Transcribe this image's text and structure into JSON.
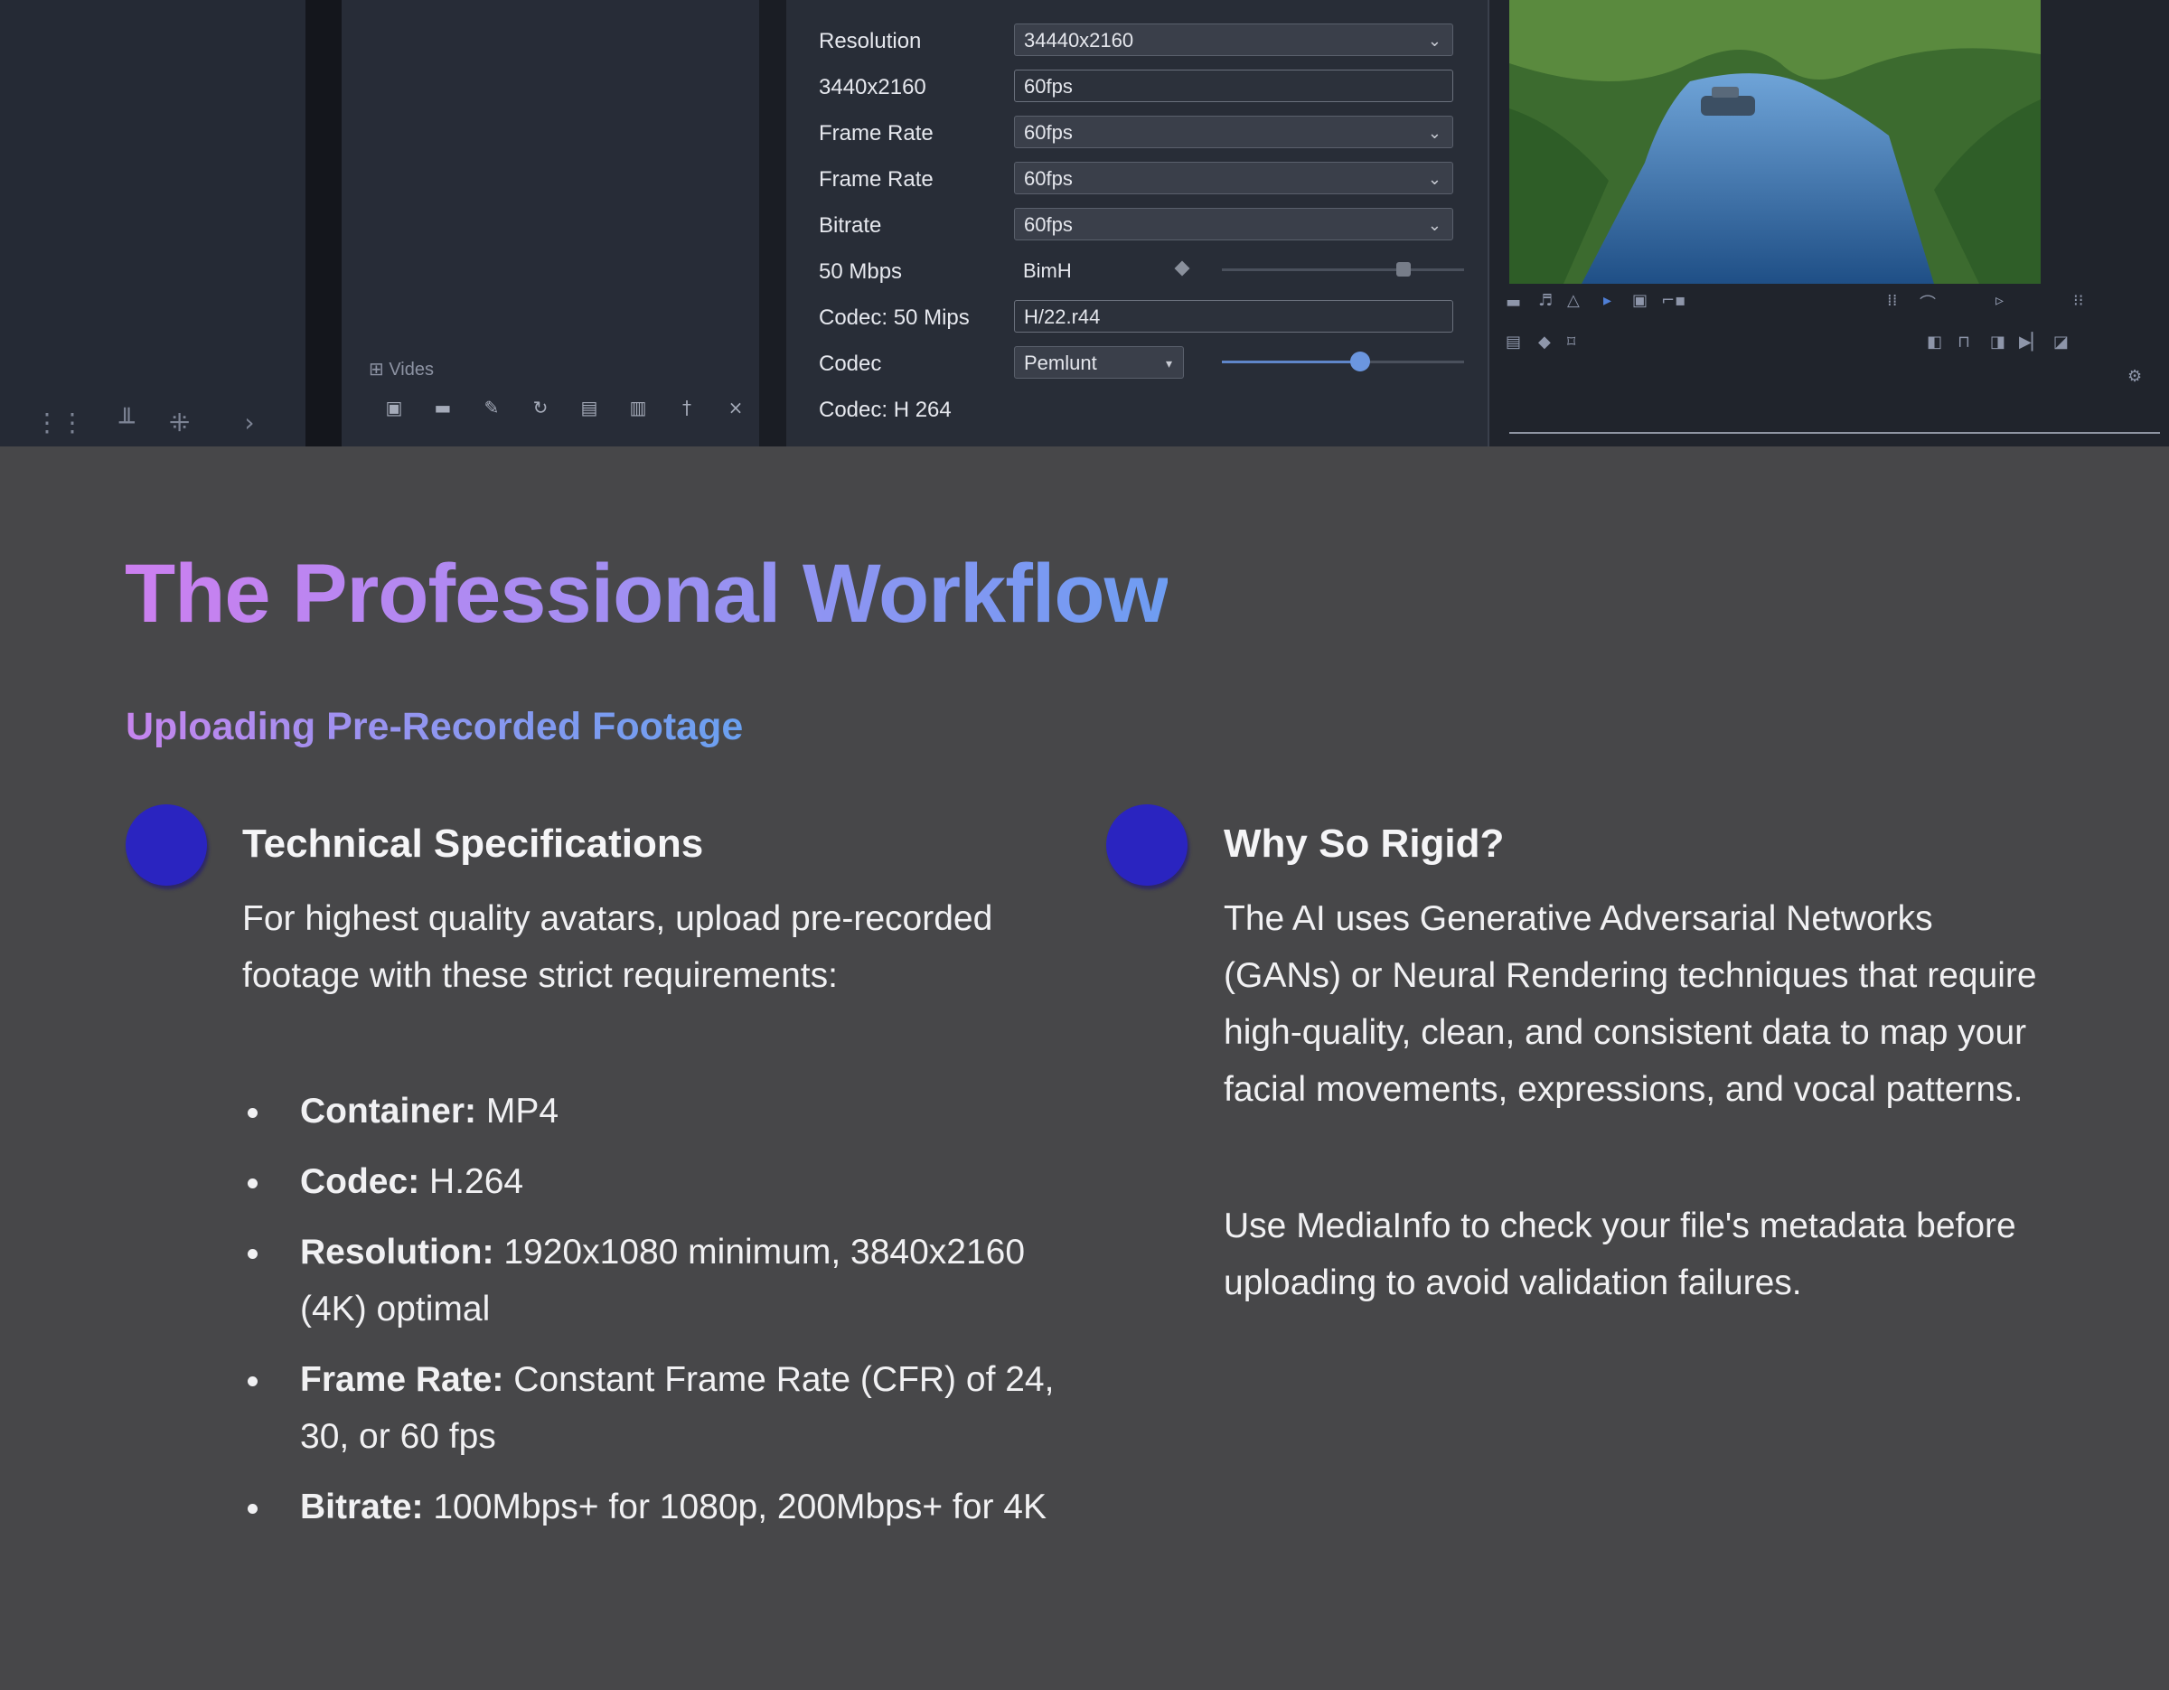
{
  "editor": {
    "panel_label": "Vides",
    "settings": [
      {
        "label": "Resolution",
        "value": "34440x2160"
      },
      {
        "label": "3440x2160",
        "value": "60fps"
      },
      {
        "label": "Frame Rate",
        "value": "60fps"
      },
      {
        "label": "Frame Rate",
        "value": "60fps"
      },
      {
        "label": "Bitrate",
        "value": "60fps"
      },
      {
        "label": "50 Mbps",
        "value": "BimH"
      },
      {
        "label": "Codec: 50 Mips",
        "value": "H/22.r44"
      },
      {
        "label": "Codec",
        "value": "Pemlunt"
      },
      {
        "label": "Codec: H 264"
      }
    ],
    "bitrate_slider_level": 0.75,
    "codec_slider_level": 0.57
  },
  "content": {
    "title_part1": "The Professional",
    "title_part2": "Workflow",
    "subtitle": "Uploading Pre-Recorded Footage",
    "left": {
      "heading": "Technical Specifications",
      "intro": "For highest quality avatars, upload pre-recorded footage with these strict requirements:",
      "bullets": [
        {
          "key": "Container:",
          "text": " MP4"
        },
        {
          "key": "Codec:",
          "text": " H.264"
        },
        {
          "key": "Resolution:",
          "text": " 1920x1080 minimum, 3840x2160 (4K) optimal"
        },
        {
          "key": "Frame Rate:",
          "text": " Constant Frame Rate (CFR) of 24, 30, or 60 fps"
        },
        {
          "key": "Bitrate:",
          "text": " 100Mbps+ for 1080p, 200Mbps+ for 4K"
        }
      ]
    },
    "right": {
      "heading": "Why So Rigid?",
      "para1": "The AI uses Generative Adversarial Networks (GANs) or Neural Rendering techniques that require high-quality, clean, and consistent data to map your facial movements, expressions, and vocal patterns.",
      "para2": "Use MediaInfo to check your file's metadata before uploading to avoid validation failures."
    }
  },
  "colors": {
    "background": "#474749",
    "dot": "#2a24c0",
    "title_gradient_start": "#cc7ff0",
    "title_gradient_end": "#6e9df2"
  }
}
